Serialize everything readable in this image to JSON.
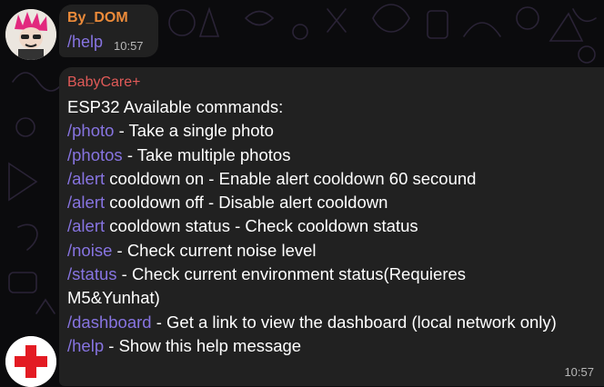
{
  "colors": {
    "background": "#0b0b0d",
    "bubble": "#212121",
    "link": "#8774e1",
    "sender_user": "#ec8b3a",
    "sender_bot": "#e05a58",
    "time": "#b7b7b7"
  },
  "messages": [
    {
      "sender": "By_DOM",
      "text": "/help",
      "time": "10:57",
      "avatar_icon": "pink-haired-punk-avatar-icon"
    },
    {
      "sender": "BabyCare+",
      "time": "10:57",
      "avatar_icon": "red-cross-icon",
      "heading": "ESP32 Available commands:",
      "lines": [
        {
          "cmd": "/photo",
          "rest": " - Take a single photo"
        },
        {
          "cmd": "/photos",
          "rest": " - Take multiple photos"
        },
        {
          "cmd": "/alert",
          "rest": " cooldown on - Enable alert cooldown 60 secound"
        },
        {
          "cmd": "/alert",
          "rest": " cooldown off - Disable alert cooldown"
        },
        {
          "cmd": "/alert",
          "rest": " cooldown status - Check cooldown status"
        },
        {
          "cmd": "/noise",
          "rest": " - Check current noise level"
        },
        {
          "cmd": "/status",
          "rest": " - Check current environment status(Requieres M5&Yunhat)"
        },
        {
          "cmd": "/dashboard",
          "rest": " - Get a link to view the dashboard (local network only)"
        },
        {
          "cmd": "/help",
          "rest": " - Show this help message"
        }
      ]
    }
  ]
}
